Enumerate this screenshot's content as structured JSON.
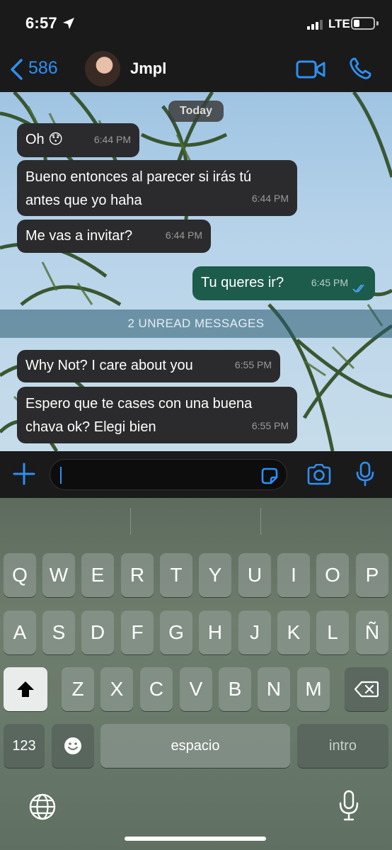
{
  "status_bar": {
    "time": "6:57",
    "network": "LTE"
  },
  "header": {
    "back_count": "586",
    "contact_name": "Jmpl"
  },
  "chat": {
    "date_label": "Today",
    "unread_label": "2 UNREAD MESSAGES",
    "messages": [
      {
        "text": "Oh 😯",
        "time": "6:44 PM",
        "direction": "incoming"
      },
      {
        "text": "Bueno entonces al parecer si irás tú\nantes que yo haha",
        "time": "6:44 PM",
        "direction": "incoming"
      },
      {
        "text": "Me vas a invitar?",
        "time": "6:44 PM",
        "direction": "incoming"
      },
      {
        "text": "Tu queres ir?",
        "time": "6:45 PM",
        "direction": "outgoing",
        "read": true
      },
      {
        "text": "Why Not? I care about you",
        "time": "6:55 PM",
        "direction": "incoming"
      },
      {
        "text": "Espero que te cases con una buena\nchava ok? Elegi bien",
        "time": "6:55 PM",
        "direction": "incoming"
      }
    ]
  },
  "input_bar": {
    "value": "",
    "icons": [
      "plus-icon",
      "sticker-icon",
      "camera-icon",
      "microphone-icon"
    ]
  },
  "keyboard": {
    "row1": [
      "Q",
      "W",
      "E",
      "R",
      "T",
      "Y",
      "U",
      "I",
      "O",
      "P"
    ],
    "row2": [
      "A",
      "S",
      "D",
      "F",
      "G",
      "H",
      "J",
      "K",
      "L",
      "Ñ"
    ],
    "row3": [
      "Z",
      "X",
      "C",
      "V",
      "B",
      "N",
      "M"
    ],
    "numbers_label": "123",
    "space_label": "espacio",
    "return_label": "intro",
    "icons": [
      "shift-icon",
      "backspace-icon",
      "emoji-icon",
      "globe-icon",
      "dictation-icon"
    ]
  },
  "colors": {
    "accent": "#2f8ff3",
    "incoming_bubble": "#2b2b2d",
    "outgoing_bubble": "#1d5c4b",
    "bar_background": "#1a1a1a"
  }
}
